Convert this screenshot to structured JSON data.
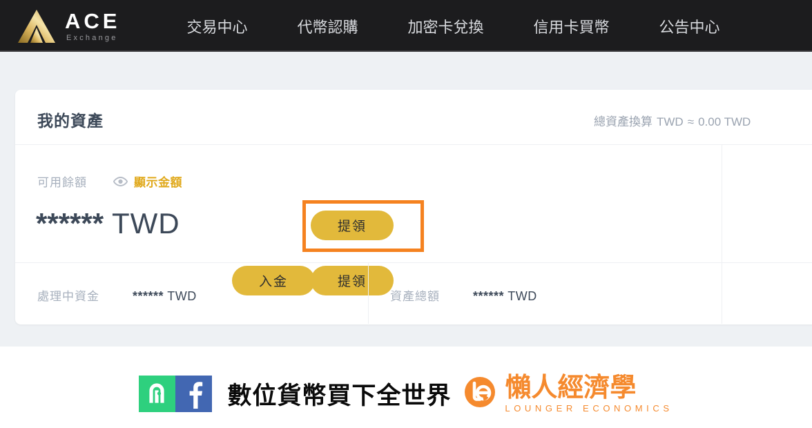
{
  "navbar": {
    "logo": {
      "mark_icon": "ace-triangle-logo-icon",
      "primary": "ACE",
      "secondary": "Exchange"
    },
    "links": [
      {
        "label": "交易中心",
        "name": "nav-link-trading-center"
      },
      {
        "label": "代幣認購",
        "name": "nav-link-token-subscription"
      },
      {
        "label": "加密卡兌換",
        "name": "nav-link-crypto-card-exchange"
      },
      {
        "label": "信用卡買幣",
        "name": "nav-link-credit-card-buy"
      },
      {
        "label": "公告中心",
        "name": "nav-link-announcement-center"
      }
    ]
  },
  "card": {
    "title": "我的資產",
    "total_label": "總資產換算",
    "total_currency": "TWD",
    "total_approx": "≈",
    "total_value": "0.00 TWD",
    "total_full": "總資產換算  TWD  ≈  0.00 TWD",
    "balance": {
      "label": "可用餘額",
      "eye_icon": "eye-icon",
      "toggle_label": "顯示金額",
      "amount_masked": "******",
      "amount_currency": "TWD",
      "deposit_button": "入金",
      "withdraw_button": "提領"
    },
    "stats": [
      {
        "label": "處理中資金",
        "value_masked": "******",
        "value_currency": "TWD"
      },
      {
        "label": "資產總額",
        "value_masked": "******",
        "value_currency": "TWD"
      }
    ]
  },
  "annotation": {
    "highlight_color": "#f58220",
    "highlight_target": "提領"
  },
  "footer": {
    "social": [
      {
        "name": "line-icon",
        "color": "#2ed07e"
      },
      {
        "name": "facebook-icon",
        "color": "#4267b2"
      }
    ],
    "slogan": "數位貨幣買下全世界",
    "brand": {
      "mark_icon": "lounger-economics-logo-icon",
      "cn": "懶人經濟學",
      "en": "LOUNGER ECONOMICS",
      "color": "#f58a2e"
    }
  },
  "colors": {
    "nav_bg": "#1c1c1e",
    "page_bg": "#eef1f4",
    "card_bg": "#ffffff",
    "gold": "#e2b93b",
    "accent_orange": "#f58220",
    "text_dark": "#3c4858",
    "text_muted": "#a7b0bd"
  }
}
